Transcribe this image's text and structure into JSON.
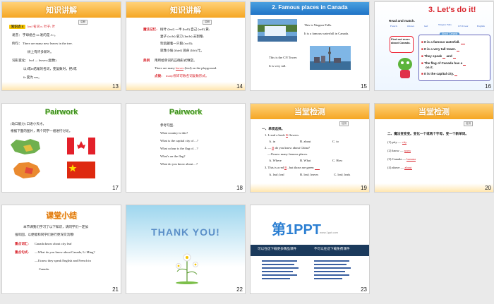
{
  "slides": [
    {
      "num": "13",
      "title": "知识讲解",
      "tag": "讲解",
      "box_label": "知识点 4",
      "box_text": "leaf 名词 n. 叶子; 叶",
      "lines": [
        "发音：  字母组合 ea 发的是 /i:/。",
        "例句：  There are many new leaves in the tree.",
        "树上有许多新叶。",
        "词形变化：  leaf → leaves (复数)",
        "以f或fe结尾的名词，变复数时，把f或",
        "fe 变为 ves。"
      ]
    },
    {
      "num": "14",
      "title": "知识讲解",
      "tag": "讲解",
      "memory_label": "魔法记忆:",
      "memory_lines": [
        "树叶 (leaf) 一半 (half) 自己 (self) 黄;",
        "妻子 (wife) 拿刀 (knife) 去割粮;",
        "架后藏着一只狼 (wolf);",
        "就像小偷 (thief) 逃命 (life) 忙。"
      ],
      "example_label": "典例",
      "example_question": "用所给单词的正确形式填空。",
      "example_sentence": "There are many",
      "example_answer": "leaves",
      "example_end": "(leaf) on the playground.",
      "tip_label": "点拨:",
      "tip_text": "many修饰可数名词复数形式。"
    },
    {
      "num": "15",
      "title": "2. Famous places in Canada",
      "caption1": "This is Niagara Falls.",
      "caption2": "It is a famous waterfall in Canada.",
      "caption3": "This is the CN Tower.",
      "caption4": "It is very tall."
    },
    {
      "num": "16",
      "title": "3. Let's do it!",
      "read_label": "Read and match.",
      "labels": [
        "French",
        "Ottawa",
        "leaf",
        "Niagara Falls",
        "CN Tower",
        "English"
      ],
      "find_out": "Find out more about Canada.",
      "about_label": "About Canada",
      "facts": [
        "It is a famous waterfall.",
        "It is a very tall tower.",
        "They speak",
        "and",
        "The flag of Canada has a",
        "on it.",
        "It is the capital city."
      ]
    },
    {
      "num": "17",
      "title": "Pairwork",
      "lines": [
        "(动口能力) 口语小天才。",
        "根据下面的图片，两个同学一组进行讨论。"
      ]
    },
    {
      "num": "18",
      "title": "Pairwork",
      "heading": "参考句型:",
      "lines": [
        "What country is this?",
        "What is the capital city of…?",
        "What colour is the flag of…?",
        "What's on the flag?",
        "What do you know about…?"
      ]
    },
    {
      "num": "19",
      "title": "当堂检测",
      "tag": "检测",
      "section": "一、单项选择。",
      "q1": "1. I read a book",
      "q1_ans": "B",
      "q1_end": "flowers.",
      "q1_opts": [
        "A. in",
        "B. about",
        "C. to"
      ],
      "q2": "2. —",
      "q2_ans": "B",
      "q2_end": "do you know about China?",
      "q2_reply": "—I know many famous places.",
      "q2_opts": [
        "A. Where",
        "B. What",
        "C. How"
      ],
      "q3": "3. This is a red",
      "q3_ans": "B",
      "q3_end": ", but those are green",
      "q3_opts": [
        "A. leaf; leaf",
        "B. leaf; leaves",
        "C. leaf; leafs"
      ]
    },
    {
      "num": "20",
      "title": "当堂检测",
      "tag": "检测",
      "section": "二、魔法变变变。变化一个或两个字母，变一个新单词。",
      "items": [
        {
          "q": "(1) pity —",
          "a": "city"
        },
        {
          "q": "(2) know —",
          "a": "snow"
        },
        {
          "q": "(3) Canada —",
          "a": "banana"
        },
        {
          "q": "(4) above —",
          "a": "about"
        }
      ]
    },
    {
      "num": "21",
      "title": "课堂小结",
      "lines": [
        "本节课我们学习了以下知识，请同学们一定加",
        "强巩固，以便能和同学们进行更深交流哦!"
      ],
      "words_label": "重点词汇:",
      "words": "Canada  know  about  city  leaf",
      "sent_label": "重点句式:",
      "sent1": "—What do you know about Canada, Li Ming?",
      "sent2": "—I know they speak English and French in",
      "sent3": "Canada."
    },
    {
      "num": "22",
      "title": "THANK YOU!"
    },
    {
      "num": "23",
      "logo": "第1PPT",
      "logo_sub": "www.1ppt.com",
      "dark1": "可以在这下载更多精品课件",
      "dark2": "不可以在这下载免费课件"
    }
  ],
  "colors": {
    "green": "#5da52c",
    "orange": "#f5a623",
    "red": "#d8242c",
    "blue": "#2a58c4"
  }
}
